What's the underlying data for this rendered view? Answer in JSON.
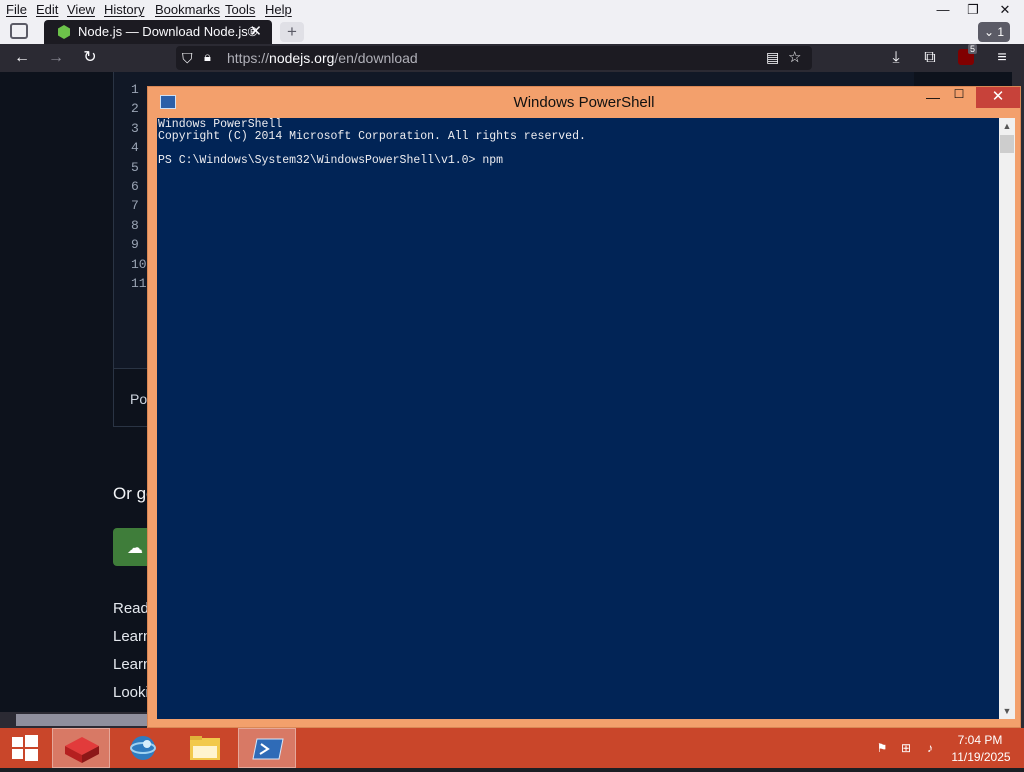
{
  "browser": {
    "menu": [
      "File",
      "Edit",
      "View",
      "History",
      "Bookmarks",
      "Tools",
      "Help"
    ],
    "tab": {
      "title": "Node.js — Download Node.js®",
      "close": "✕"
    },
    "new_tab": "+",
    "tab_count": "1",
    "url": {
      "scheme": "https://",
      "host": "nodejs.org",
      "path": "/en/download"
    },
    "extension_badge": "5",
    "window_controls": {
      "minimize": "—",
      "restore": "❐",
      "close": "✕"
    }
  },
  "webpage": {
    "line_numbers": [
      "1",
      "2",
      "3",
      "4",
      "5",
      "6",
      "7",
      "8",
      "9",
      "10",
      "11"
    ],
    "os_label": "Po",
    "or_get": "Or ge",
    "links": [
      "Read",
      "Learn",
      "Learn",
      "Looki"
    ]
  },
  "powershell": {
    "title": "Windows PowerShell",
    "lines": [
      "Windows PowerShell",
      "Copyright (C) 2014 Microsoft Corporation. All rights reserved.",
      "",
      "PS C:\\Windows\\System32\\WindowsPowerShell\\v1.0> npm"
    ],
    "controls": {
      "minimize": "—",
      "maximize": "☐",
      "close": "✕"
    }
  },
  "taskbar": {
    "apps": [
      "start",
      "app-red",
      "browser",
      "file-explorer",
      "powershell"
    ],
    "clock": {
      "time": "7:04 PM",
      "date": "11/19/2025"
    }
  },
  "colors": {
    "taskbar": "#c9462a",
    "console_bg": "#012456",
    "ps_frame": "#f3a06c"
  }
}
